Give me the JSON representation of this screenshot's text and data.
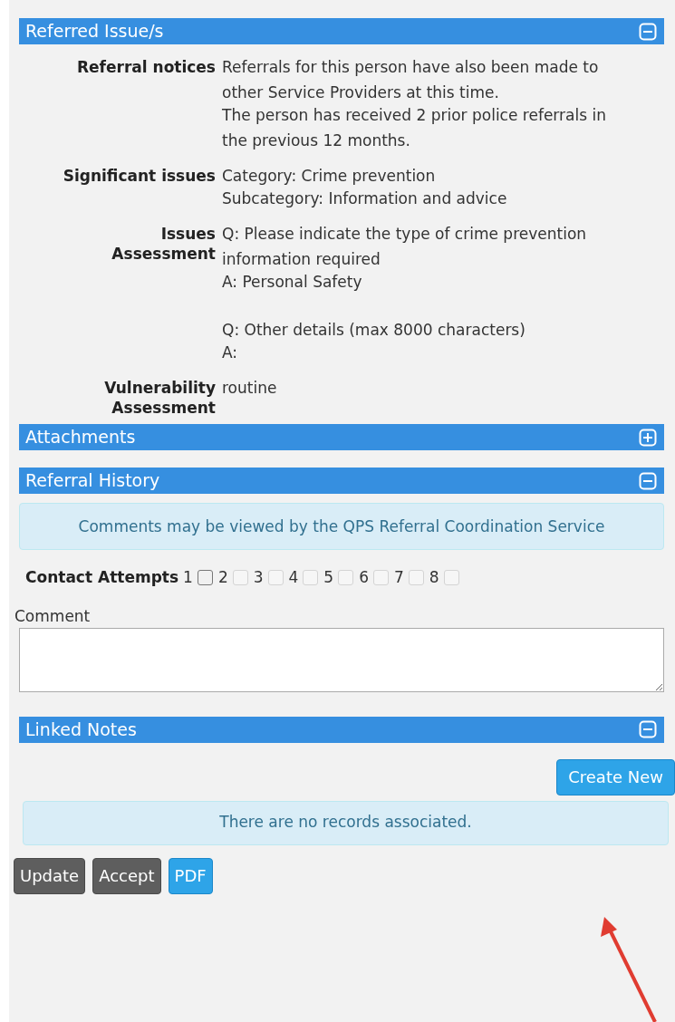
{
  "sections": [
    {
      "kind": "details",
      "title": "Referred Issue/s",
      "expanded": true,
      "rows": [
        {
          "label_lines": [
            "Referral notices"
          ],
          "paragraphs": [
            [
              "Referrals for this person have also been made to other Service Providers at this time.",
              "The person has received 2 prior police referrals in the previous 12 months."
            ]
          ]
        },
        {
          "label_lines": [
            "Significant issues"
          ],
          "paragraphs": [
            [
              "Category: Crime prevention",
              "Subcategory: Information and advice"
            ]
          ]
        },
        {
          "label_lines": [
            "Issues",
            "Assessment"
          ],
          "paragraphs": [
            [
              "Q: Please indicate the type of crime prevention information required",
              "A: Personal Safety"
            ],
            [
              "Q: Other details (max 8000 characters)",
              "A:"
            ]
          ]
        },
        {
          "label_lines": [
            "Vulnerability",
            "Assessment"
          ],
          "paragraphs": [
            [
              "routine"
            ]
          ]
        }
      ]
    },
    {
      "kind": "collapsed",
      "title": "Attachments",
      "expanded": false
    },
    {
      "kind": "history",
      "title": "Referral History",
      "expanded": true,
      "notice": "Comments may be viewed by the QPS Referral Coordination Service",
      "contact_label": "Contact Attempts",
      "attempts": [
        {
          "label": "1",
          "checked": false,
          "disabled": false
        },
        {
          "label": "2",
          "checked": false,
          "disabled": true
        },
        {
          "label": "3",
          "checked": false,
          "disabled": true
        },
        {
          "label": "4",
          "checked": false,
          "disabled": true
        },
        {
          "label": "5",
          "checked": false,
          "disabled": true
        },
        {
          "label": "6",
          "checked": false,
          "disabled": true
        },
        {
          "label": "7",
          "checked": false,
          "disabled": true
        },
        {
          "label": "8",
          "checked": false,
          "disabled": true
        }
      ],
      "comment_label": "Comment"
    },
    {
      "kind": "notes",
      "title": "Linked Notes",
      "expanded": true,
      "button": "Create New",
      "notice": "There are no records associated."
    }
  ],
  "actions": [
    {
      "label": "Update",
      "kind": "dark"
    },
    {
      "label": "Accept",
      "kind": "dark"
    },
    {
      "label": "PDF",
      "kind": "primary"
    }
  ]
}
